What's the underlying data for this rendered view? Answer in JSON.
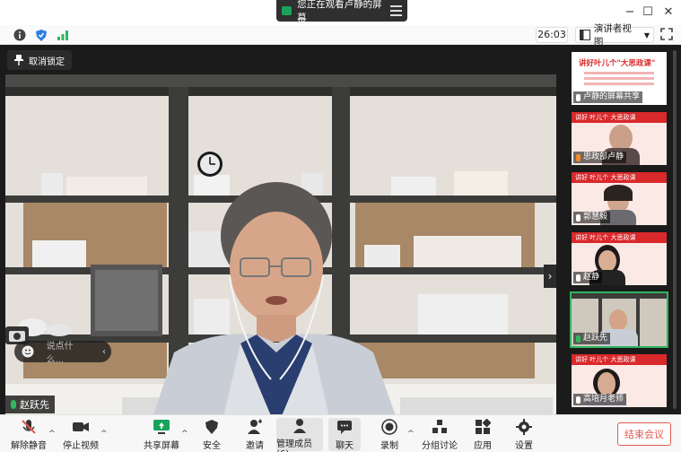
{
  "banner": {
    "text": "您正在观看卢静的屏幕"
  },
  "window": {
    "min": "−",
    "max": "☐",
    "close": "✕"
  },
  "infobar": {
    "timer": "26:03",
    "view_label": "演讲者视图"
  },
  "stage": {
    "unlock_label": "取消锁定",
    "chat_placeholder": "说点什么...",
    "speaker_name": "赵跃先"
  },
  "gallery": [
    {
      "name": "卢静的屏幕共享",
      "kind": "slide",
      "mic": "muted",
      "header": "讲好叶儿个\"大思政课\""
    },
    {
      "name": "思政部卢静",
      "kind": "slide-person",
      "mic": "orange",
      "header": "讲好 叶儿个 大思政课"
    },
    {
      "name": "郭慧毅",
      "kind": "slide-person",
      "mic": "muted",
      "header": "讲好 叶儿个 大思政课"
    },
    {
      "name": "赵静",
      "kind": "slide-person",
      "mic": "muted",
      "header": "讲好 叶儿个 大思政课"
    },
    {
      "name": "赵跃先",
      "kind": "person",
      "mic": "on",
      "active": true
    },
    {
      "name": "高培月老师",
      "kind": "slide-person",
      "mic": "muted",
      "header": "讲好 叶儿个 大思政课"
    }
  ],
  "toolbar": {
    "mute": "解除静音",
    "video": "停止视频",
    "share": "共享屏幕",
    "security": "安全",
    "invite": "邀请",
    "members": "管理成员(6)",
    "chat": "聊天",
    "record": "录制",
    "breakout": "分组讨论",
    "apps": "应用",
    "settings": "设置",
    "end": "结束会议"
  },
  "colors": {
    "accent_green": "#2fb85d",
    "end_red": "#e25a4f",
    "slide_red": "#d9292b"
  }
}
